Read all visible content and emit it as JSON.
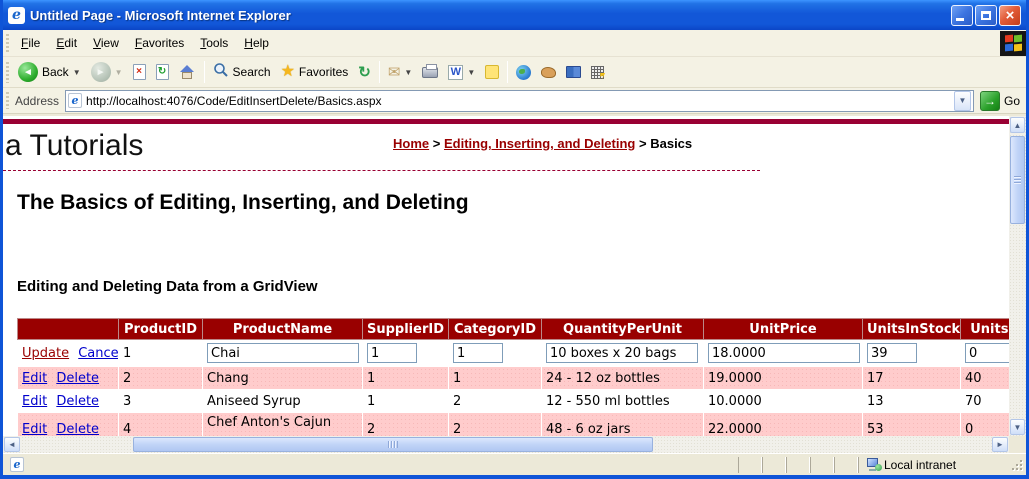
{
  "window": {
    "title": "Untitled Page - Microsoft Internet Explorer"
  },
  "menu_bar": {
    "items": [
      "File",
      "Edit",
      "View",
      "Favorites",
      "Tools",
      "Help"
    ]
  },
  "toolbar": {
    "back": "Back",
    "search": "Search",
    "favorites": "Favorites"
  },
  "address_bar": {
    "label": "Address",
    "url": "http://localhost:4076/Code/EditInsertDelete/Basics.aspx",
    "go": "Go"
  },
  "page": {
    "site_title_visible": "a Tutorials",
    "breadcrumb": {
      "home": "Home",
      "separator": ">",
      "section": "Editing, Inserting, and Deleting",
      "current": "Basics"
    },
    "heading": "The Basics of Editing, Inserting, and Deleting",
    "subheading": "Editing and Deleting Data from a GridView"
  },
  "grid": {
    "columns": [
      "",
      "ProductID",
      "ProductName",
      "SupplierID",
      "CategoryID",
      "QuantityPerUnit",
      "UnitPrice",
      "UnitsInStock",
      "UnitsOnOrder"
    ],
    "edit_row": {
      "update": "Update",
      "cancel": "Cancel",
      "product_id": "1",
      "product_name": "Chai",
      "supplier_id": "1",
      "category_id": "1",
      "quantity_per_unit": "10 boxes x 20 bags",
      "unit_price": "18.0000",
      "units_in_stock": "39",
      "units_on_order": "0"
    },
    "rows": [
      {
        "edit": "Edit",
        "delete": "Delete",
        "cells": [
          "2",
          "Chang",
          "1",
          "1",
          "24 - 12 oz bottles",
          "19.0000",
          "17",
          "40"
        ]
      },
      {
        "edit": "Edit",
        "delete": "Delete",
        "cells": [
          "3",
          "Aniseed Syrup",
          "1",
          "2",
          "12 - 550 ml bottles",
          "10.0000",
          "13",
          "70"
        ]
      },
      {
        "edit": "Edit",
        "delete": "Delete",
        "cells": [
          "4",
          "Chef Anton's Cajun",
          "2",
          "2",
          "48 - 6 oz jars",
          "22.0000",
          "53",
          "0"
        ]
      }
    ]
  },
  "status_bar": {
    "zone": "Local intranet"
  },
  "colors": {
    "titlebar_blue": "#1257d8",
    "top_rule_maroon": "#990033",
    "grid_header_bg": "#990000",
    "grid_alt_row_bg": "#ffcccc",
    "link_red": "#990000",
    "link_blue": "#0000cc",
    "go_green": "#2aa02a"
  }
}
